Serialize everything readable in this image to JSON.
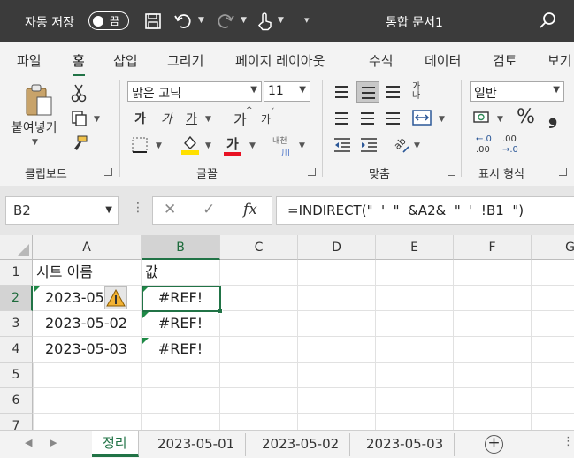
{
  "titlebar": {
    "autosave_label": "자동 저장",
    "toggle_state": "끔",
    "doc_title": "통합 문서1"
  },
  "ribbon_tabs": [
    "파일",
    "홈",
    "삽입",
    "그리기",
    "페이지 레이아웃",
    "수식",
    "데이터",
    "검토",
    "보기"
  ],
  "active_tab": "홈",
  "clipboard": {
    "paste_label": "붙여넣기",
    "group_label": "클립보드"
  },
  "font": {
    "name": "맑은 고딕",
    "size": "11",
    "group_label": "글꼴",
    "bold": "가",
    "italic": "가",
    "underline": "가",
    "grow": "가",
    "shrink": "가",
    "font_color_glyph": "가",
    "phonetic": "내천"
  },
  "alignment": {
    "group_label": "맞춤",
    "wrap_glyph": "가나"
  },
  "number": {
    "format": "일반",
    "group_label": "표시 형식",
    "percent": "%",
    "comma": "❟",
    "inc_decimal": ".00",
    "dec_decimal": ".00"
  },
  "formula_bar": {
    "name_box": "B2",
    "formula": "=INDIRECT(\"  '  \"  &A2&  \"  '  !B1  \")"
  },
  "grid": {
    "columns": [
      "A",
      "B",
      "C",
      "D",
      "E",
      "F",
      "G"
    ],
    "rows": [
      "1",
      "2",
      "3",
      "4",
      "5",
      "6",
      "7"
    ],
    "cells": {
      "A1": "시트 이름",
      "B1": "값",
      "A2": "2023-05",
      "B2": "#REF!",
      "A3": "2023-05-02",
      "B3": "#REF!",
      "A4": "2023-05-03",
      "B4": "#REF!"
    }
  },
  "sheets": [
    "정리",
    "2023-05-01",
    "2023-05-02",
    "2023-05-03"
  ],
  "active_sheet": "정리",
  "colors": {
    "accent": "#217346",
    "titlebar": "#3b3b3b",
    "font_color_bar": "#e81123",
    "fill_color_bar": "#ffe000"
  }
}
